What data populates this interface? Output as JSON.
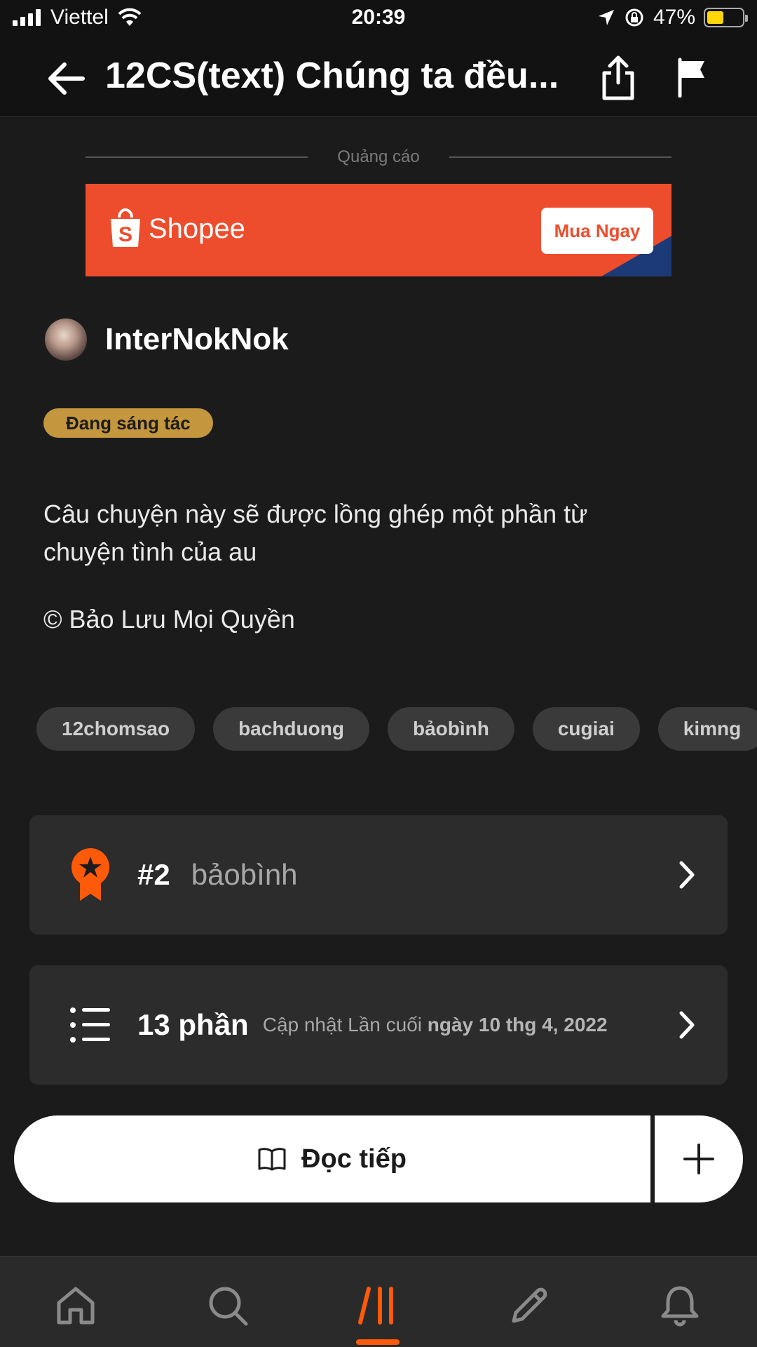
{
  "status_bar": {
    "carrier": "Viettel",
    "time": "20:39",
    "battery": "47%",
    "battery_level": 0.47
  },
  "header": {
    "title": "12CS(text) Chúng ta đều...",
    "back_icon": "arrow-left-icon",
    "share_icon": "share-icon",
    "flag_icon": "flag-icon"
  },
  "ad": {
    "label": "Quảng cáo",
    "brand": "Shopee",
    "cta": "Mua Ngay",
    "color": "#ee4d2d"
  },
  "author": {
    "name": "InterNokNok"
  },
  "story": {
    "status": "Đang sáng tác",
    "description": "Câu chuyện này sẽ được lồng ghép một phần từ chuyện tình của au",
    "copyright": "© Bảo Lưu Mọi Quyền"
  },
  "tags": [
    "12chomsao",
    "bachduong",
    "bảobình",
    "cugiai",
    "kimng"
  ],
  "ranking": {
    "rank": "#2",
    "tag": "bảobình",
    "icon": "award-ribbon-icon"
  },
  "parts": {
    "count": "13 phần",
    "updated_prefix": "Cập nhật Lần cuối",
    "updated_date": "ngày 10 thg 4, 2022",
    "icon": "list-icon"
  },
  "actions": {
    "read_label": "Đọc tiếp",
    "read_icon": "open-book-icon",
    "add_icon": "plus-icon"
  },
  "nav": {
    "items": [
      "home-icon",
      "search-icon",
      "library-icon",
      "write-icon",
      "notifications-icon"
    ],
    "active": "library-icon",
    "accent": "#ff5a0a"
  }
}
